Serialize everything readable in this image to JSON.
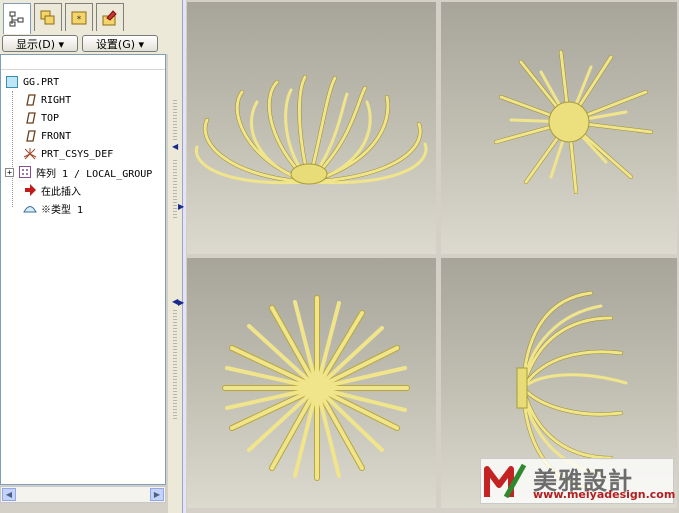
{
  "panel": {
    "menus": {
      "show_label": "显示(D) ▾",
      "settings_label": "设置(G) ▾"
    },
    "tabs": [
      {
        "icon": "model-tree-icon",
        "active": true
      },
      {
        "icon": "folder-browser-icon",
        "active": false
      },
      {
        "icon": "favorites-icon",
        "active": false
      },
      {
        "icon": "connections-icon",
        "active": false
      }
    ],
    "tree": {
      "root": "GG.PRT",
      "items": [
        {
          "label": "RIGHT",
          "icon": "datum-plane-icon"
        },
        {
          "label": "TOP",
          "icon": "datum-plane-icon"
        },
        {
          "label": "FRONT",
          "icon": "datum-plane-icon"
        },
        {
          "label": "PRT_CSYS_DEF",
          "icon": "coordinate-system-icon"
        },
        {
          "label": "阵列 1 / LOCAL_GROUP",
          "icon": "pattern-icon"
        },
        {
          "label": "在此插入",
          "icon": "insert-here-arrow-icon"
        },
        {
          "label": "※类型 1",
          "icon": "style-feature-icon"
        }
      ]
    }
  },
  "viewports": [
    {
      "name": "front-view",
      "icon": "flower-model-front"
    },
    {
      "name": "isometric-view",
      "icon": "flower-model-iso"
    },
    {
      "name": "top-view",
      "icon": "flower-model-top"
    },
    {
      "name": "side-view",
      "icon": "flower-model-side"
    }
  ],
  "watermark": {
    "brand": "美雅設計",
    "url": "www.meiyadesign.com"
  },
  "colors": {
    "model": "#f0e58a",
    "model_dark": "#b8a83a",
    "viewport_bg": "#bab8ac",
    "panel_bg": "#ece9d8"
  }
}
